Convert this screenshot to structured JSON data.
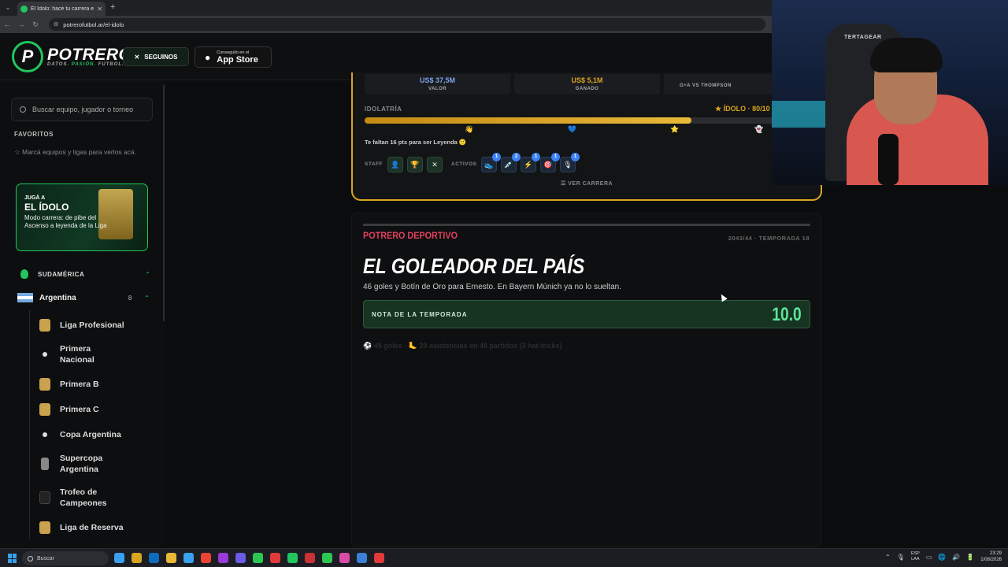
{
  "browser": {
    "tab_title": "El Ídolo: hacé tu carrera en la Liga",
    "tab_close": "✕",
    "new_tab": "+",
    "url": "potrerofutbol.ar/el-idolo",
    "tabs_dropdown": "⌄",
    "back": "←",
    "forward": "→",
    "reload": "↻",
    "site_info": "⚙"
  },
  "header": {
    "logo_letter": "P",
    "logo_name": "POTRERO",
    "tagline_1": "DATOS.",
    "tagline_2": "PASIÓN.",
    "tagline_3": "FÚTBOL.",
    "x_icon": "✕",
    "follow_label": "SEGUINOS",
    "store_small": "Conseguilo en el",
    "store_big": "App Store",
    "apple_icon": "",
    "apple_glyph": "●"
  },
  "sidebar": {
    "search_placeholder": "Buscar equipo, jugador o torneo",
    "favorites_title": "FAVORITOS",
    "favorites_star": "☆",
    "favorites_hint": "Marcá equipos y ligas para verlos acá.",
    "promo": {
      "kicker": "JUGÁ A",
      "title": "EL ÍDOLO",
      "desc": "Modo carrera: de pibe del Ascenso a leyenda de la Liga"
    },
    "region": "SUDAMÉRICA",
    "region_chevron": "⌃",
    "country": "Argentina",
    "country_count": "8",
    "country_chevron": "⌃",
    "leagues": [
      {
        "label": "Liga Profesional"
      },
      {
        "label": "Primera Nacional"
      },
      {
        "label": "Primera B"
      },
      {
        "label": "Primera C"
      },
      {
        "label": "Copa Argentina"
      },
      {
        "label": "Supercopa Argentina"
      },
      {
        "label": "Trofeo de Campeones"
      },
      {
        "label": "Liga de Reserva"
      }
    ]
  },
  "career": {
    "stats": [
      {
        "value": "US$ 37,5M",
        "label": "VALOR"
      },
      {
        "value": "US$ 5,1M",
        "label": "GANADO"
      },
      {
        "value": "",
        "label": "G+A VS THOMPSON"
      }
    ],
    "idolatria_label": "IDOLATRÍA",
    "idolatria_value": "ÍDOLO · 80/10",
    "idolatria_star": "★",
    "idolatria_progress": 0.79,
    "markers": [
      "👋",
      "💙",
      "⭐",
      "👻"
    ],
    "points_hint": "Te faltan 16 pts para ser Leyenda",
    "points_icon": "🙂",
    "staff_label": "STAFF",
    "staff_icons": [
      "👤",
      "🏆",
      "✕"
    ],
    "active_label": "ACTIVOS",
    "active_items": [
      {
        "icon": "👟",
        "count": "1"
      },
      {
        "icon": "💉",
        "count": "2"
      },
      {
        "icon": "⚡",
        "count": "1"
      },
      {
        "icon": "🎯",
        "count": "1"
      },
      {
        "icon": "🎙",
        "count": "1"
      }
    ],
    "view_career": "VER CARRERA",
    "view_career_icon": "☰"
  },
  "news": {
    "source": "POTRERO DEPORTIVO",
    "date": "2043/44 · TEMPORADA 18",
    "title": "EL GOLEADOR DEL PAÍS",
    "subtitle": "46 goles y Botín de Oro para Ernesto. En Bayern Múnich ya no lo sueltan.",
    "rating_label": "NOTA DE LA TEMPORADA",
    "rating_value": "10.0",
    "ghost_line": "⚽ 45 goles · 🦶 20 asistencias en 48 partidos (3 hat-tricks)"
  },
  "webcam": {
    "chair_brand": "TERTAGEAR"
  },
  "taskbar": {
    "search_label": "Buscar",
    "lang_1": "ESP",
    "lang_2": "LAA",
    "time": "23:29",
    "date": "1/08/2026",
    "tray_up": "⌃",
    "tray_icons": [
      "🎙",
      "▭",
      "🌐",
      "🔊",
      "🔋"
    ],
    "app_colors": [
      "#3aa0f0",
      "#d9a520",
      "#0f6cbd",
      "#e8b838",
      "#3aa0f0",
      "#ea4335",
      "#9a3bd9",
      "#6b5be5",
      "#2dc653",
      "#e03a3a",
      "#22c55e",
      "#c83232",
      "#2dc653",
      "#d94ba8",
      "#3a80d9",
      "#e03a3a"
    ]
  }
}
